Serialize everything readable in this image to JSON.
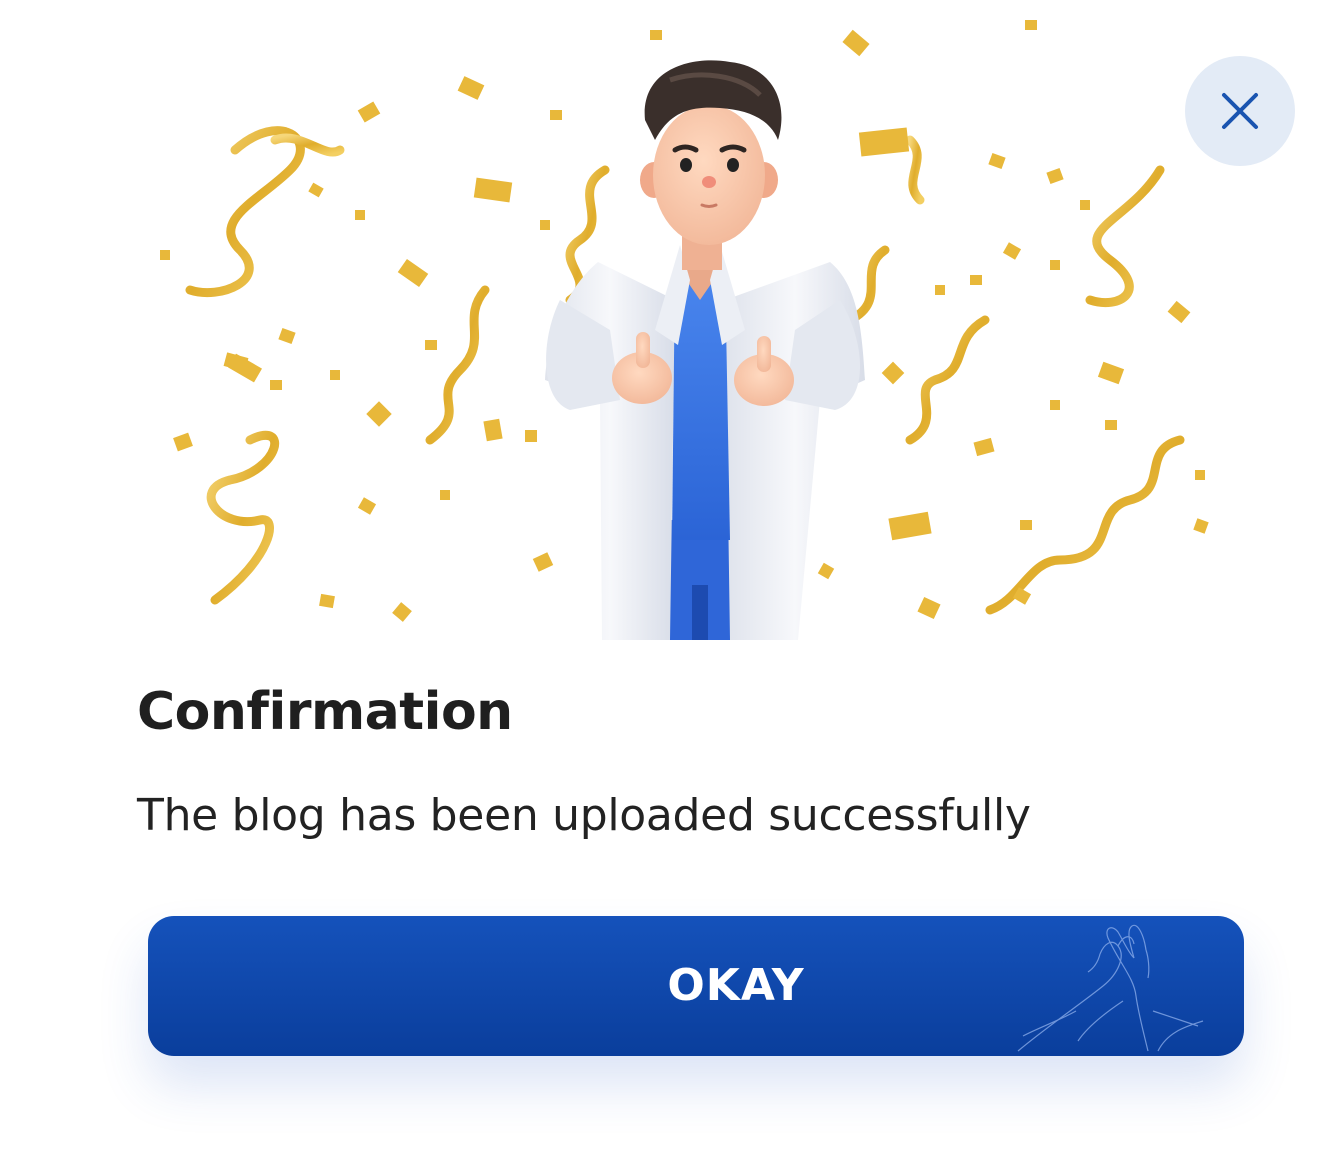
{
  "dialog": {
    "title": "Confirmation",
    "message": "The blog has been uploaded successfully",
    "okay_label": "OKAY",
    "close_icon": "close-icon",
    "illustration": "doctor-thumbs-up-confetti",
    "decoration_icon": "high-five-hands-icon"
  },
  "colors": {
    "primary": "#0a3e9c",
    "primary_light": "#1552bb",
    "close_bg": "#e3ebf6",
    "close_icon": "#1a54b0",
    "confetti": "#e8b83a",
    "title_text": "#1f1f1f",
    "body_text": "#222222"
  }
}
